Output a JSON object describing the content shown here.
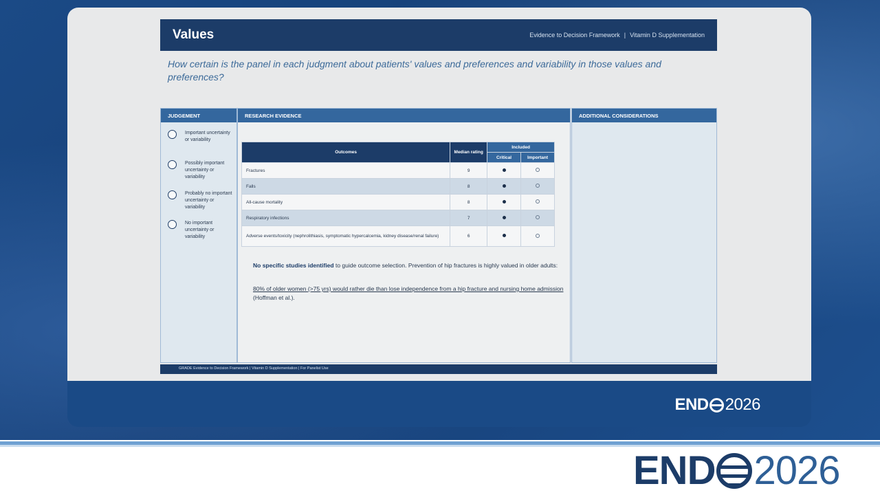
{
  "slide": {
    "title": "Values",
    "breadcrumb": [
      "Evidence to Decision Framework",
      "|",
      "Vitamin D Supplementation"
    ],
    "question": "How certain is the panel in each judgment about patients' values and preferences and variability in those values and preferences?"
  },
  "judgement": {
    "header": "JUDGEMENT",
    "options": [
      {
        "label": "Important uncertainty or variability"
      },
      {
        "label": "Possibly important uncertainty or variability"
      },
      {
        "label": "Probably no important uncertainty or variability"
      },
      {
        "label": "No important uncertainty or variability"
      }
    ]
  },
  "research": {
    "header": "RESEARCH EVIDENCE",
    "table": {
      "headers": {
        "outcomes": "Outcomes",
        "median": "Median rating",
        "included": "Included",
        "critical": "Critical",
        "important": "Important"
      },
      "rows": [
        {
          "outcome": "Fractures",
          "rating": "9",
          "critical": true,
          "important": false
        },
        {
          "outcome": "Falls",
          "rating": "8",
          "critical": true,
          "important": false
        },
        {
          "outcome": "All-cause mortality",
          "rating": "8",
          "critical": true,
          "important": false
        },
        {
          "outcome": "Respiratory infections",
          "rating": "7",
          "critical": true,
          "important": false
        },
        {
          "outcome": "Adverse events/toxicity (nephrolithiasis, symptomatic hypercalcemia, kidney disease/renal failure)",
          "rating": "6",
          "critical": true,
          "important": false
        }
      ]
    },
    "note1_bold": "No specific studies identified",
    "note1_rest": " to guide outcome selection. Prevention of hip fractures is highly valued in older adults:",
    "note2_underlined": "80% of older women (>75 yrs) would rather die than lose independence from a hip fracture and nursing home admission ",
    "note2_rest": "(Hoffman et al.)."
  },
  "additional": {
    "header": "ADDITIONAL CONSIDERATIONS"
  },
  "footer": {
    "text": "GRADE Evidence to Decision Framework  |  Vitamin D Supplementation  |  For Panelist Use"
  },
  "branding": {
    "logo_bold": "END",
    "logo_year": "2026"
  },
  "colors": {
    "navy": "#1c3c68",
    "header_blue": "#34679e",
    "question_blue": "#3c6a99",
    "accent_line": "#6fa1d2"
  }
}
